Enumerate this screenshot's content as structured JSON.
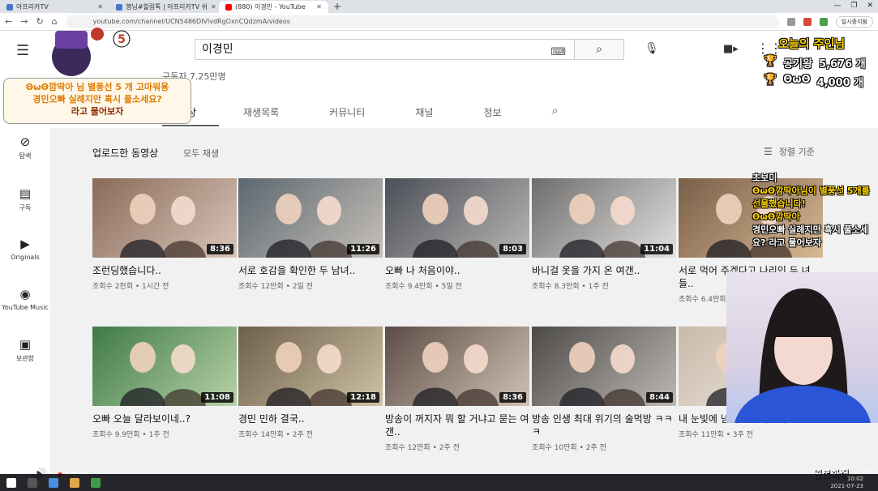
{
  "browser": {
    "tabs": [
      {
        "label": "아프리카TV",
        "active": false
      },
      {
        "label": "행님#힐링톡 | 아프리카TV 쉬",
        "active": false
      },
      {
        "label": "(880) 이경민 - YouTube",
        "active": true
      }
    ],
    "url": "youtube.com/channel/UCN5486DIVlvdRgOxnCQdzmA/videos",
    "profile": "일시중지됨"
  },
  "youtube": {
    "search_value": "이경민",
    "subscribers": "구독자 7.25만명",
    "channel_tabs": [
      "동영상",
      "재생목록",
      "커뮤니티",
      "채널",
      "정보"
    ],
    "channel_tab_active_visible": "상",
    "sidebar": [
      {
        "icon": "compass-icon",
        "label": "탐색"
      },
      {
        "icon": "subscriptions-icon",
        "label": "구독"
      },
      {
        "icon": "originals-icon",
        "label": "Originals"
      },
      {
        "icon": "music-icon",
        "label": "YouTube Music"
      },
      {
        "icon": "library-icon",
        "label": "보관함"
      }
    ],
    "section_title": "업로드한 동영상",
    "play_all": "모두 재생",
    "sort_label": "정렬 기준",
    "videos": [
      {
        "title": "조런딩했습니다..",
        "meta": "조회수 2천회 • 1시간 전",
        "duration": "8:36",
        "colors": [
          "#8a6a5a",
          "#d9c6b8"
        ]
      },
      {
        "title": "서로 호감을 확인한 두 남녀..",
        "meta": "조회수 12만회 • 2일 전",
        "duration": "11:26",
        "colors": [
          "#5b6770",
          "#c7c0b8"
        ]
      },
      {
        "title": "오빠 나 처음이야..",
        "meta": "조회수 9.4만회 • 5일 전",
        "duration": "8:03",
        "colors": [
          "#4b4f58",
          "#b9b6b3"
        ]
      },
      {
        "title": "바니걸 옷을 가지 온 여갠..",
        "meta": "조회수 8.3만회 • 1주 전",
        "duration": "11:04",
        "colors": [
          "#6f6d6c",
          "#e3e1df"
        ]
      },
      {
        "title": "서로 먹어 주겠다고 나리인 두 녀들..",
        "meta": "조회수 6.4만회 • 1주 전",
        "duration": "",
        "colors": [
          "#7a5e48",
          "#d7b894"
        ]
      },
      {
        "title": "오빠 오늘 달라보이네..?",
        "meta": "조회수 9.9만회 • 1주 전",
        "duration": "11:08",
        "colors": [
          "#3f7a45",
          "#b8d2a9"
        ]
      },
      {
        "title": "경민 민하 결국..",
        "meta": "조회수 14만회 • 2주 전",
        "duration": "12:18",
        "colors": [
          "#6e5f4a",
          "#cfc2a6"
        ]
      },
      {
        "title": "방송이 꺼지자 뭐 할 거냐고 묻는 여갠..",
        "meta": "조회수 12만회 • 2주 전",
        "duration": "8:36",
        "colors": [
          "#5b4d46",
          "#d2c2b5"
        ]
      },
      {
        "title": "방송 인생 최대 위기의 술먹방 ㅋㅋㅋ",
        "meta": "조회수 10만회 • 2주 전",
        "duration": "8:44",
        "colors": [
          "#4c4a48",
          "#bdb8b2"
        ]
      },
      {
        "title": "내 눈빛에 넘어오는 여갠이..",
        "meta": "조회수 11만회 • 3주 전",
        "duration": "",
        "colors": [
          "#c9b9a8",
          "#f1ebe5"
        ]
      }
    ]
  },
  "overlay": {
    "notice_lines": [
      "ΘωΘ깜딱아 님 별풍선 5 개 고마워용",
      "경민오빠 실례지만 혹시 풀소세요?",
      "라고 물어보자"
    ],
    "rank_title": "오늘의 주인님",
    "ranking": [
      {
        "name": "공기왕",
        "amount": "5,676 개"
      },
      {
        "name": "ΘωΘ",
        "amount": "4,000 개"
      }
    ],
    "chat_lines": [
      "초보미",
      "ΘωΘ깜딱아님이 별풍선 5개를 선물했습니다!",
      "ΘωΘ깜딱아",
      "경민오빠 실례지만 혹시 풀소세요? 라고 물어보자"
    ],
    "quality_label": "원본화질"
  },
  "player": {
    "live_label": "LIVE"
  },
  "taskbar": {
    "time": "10:02",
    "date": "2021-07-23"
  }
}
